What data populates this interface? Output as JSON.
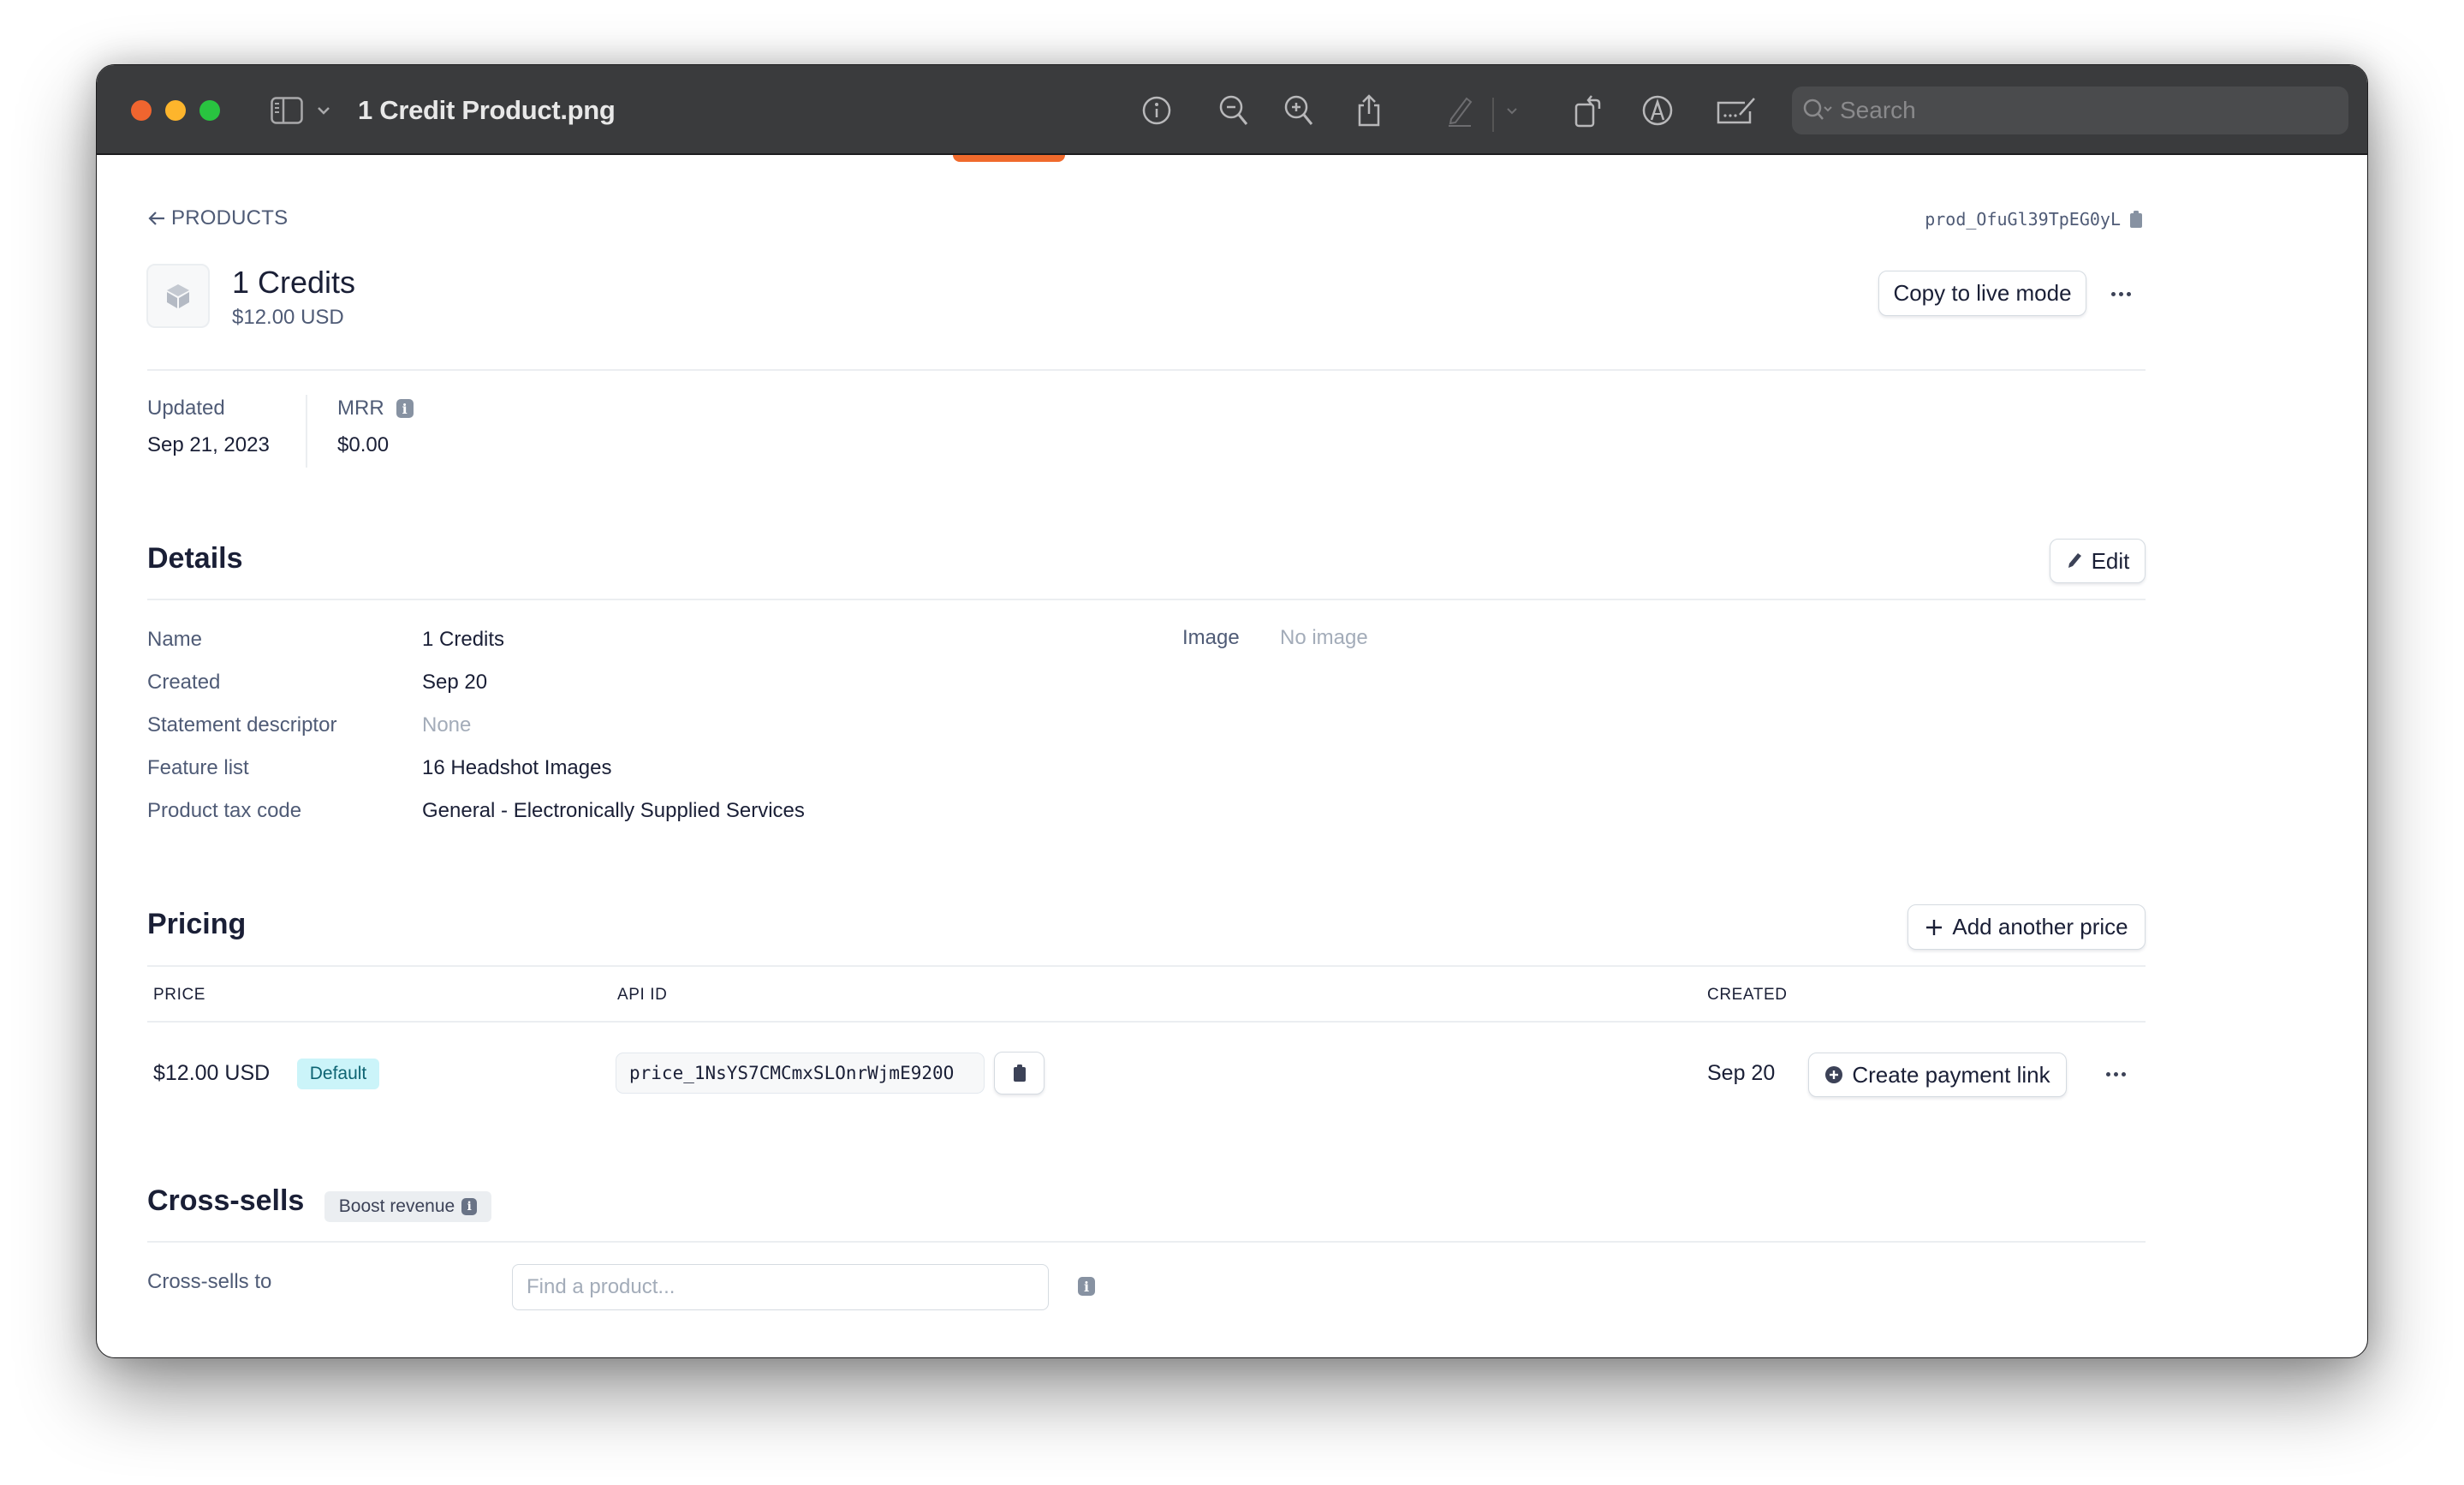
{
  "window": {
    "title": "1 Credit Product.png",
    "search_placeholder": "Search",
    "toolbar_icons": [
      "info-icon",
      "zoom-out-icon",
      "zoom-in-icon",
      "share-icon",
      "markup-pen-icon",
      "chevron-down-icon",
      "rotate-icon",
      "annotate-icon",
      "signature-icon"
    ],
    "traffic_lights": {
      "close": "#f0652f",
      "minimize": "#fdb52c",
      "maximize": "#29c440"
    }
  },
  "page": {
    "back_link": "PRODUCTS",
    "product_id": "prod_OfuGl39TpEG0yL",
    "product": {
      "name": "1 Credits",
      "price": "$12.00 USD"
    },
    "actions": {
      "copy_live": "Copy to live mode"
    },
    "stats": [
      {
        "label": "Updated",
        "value": "Sep 21, 2023"
      },
      {
        "label": "MRR",
        "value": "$0.00"
      }
    ],
    "details": {
      "title": "Details",
      "edit_label": "Edit",
      "rows": [
        {
          "label": "Name",
          "value": "1 Credits"
        },
        {
          "label": "Created",
          "value": "Sep 20"
        },
        {
          "label": "Statement descriptor",
          "value": "None"
        },
        {
          "label": "Feature list",
          "value": "16 Headshot Images"
        },
        {
          "label": "Product tax code",
          "value": "General - Electronically Supplied Services"
        }
      ],
      "image": {
        "label": "Image",
        "value": "No image"
      }
    },
    "pricing": {
      "title": "Pricing",
      "add_label": "Add another price",
      "columns": [
        "PRICE",
        "API ID",
        "CREATED"
      ],
      "rows": [
        {
          "price": "$12.00 USD",
          "badge": "Default",
          "api_id": "price_1NsYS7CMCmxSLOnrWjmE920O",
          "created": "Sep 20",
          "action": "Create payment link"
        }
      ]
    },
    "cross_sells": {
      "title": "Cross-sells",
      "badge": "Boost revenue",
      "field_label": "Cross-sells to",
      "input_placeholder": "Find a product...",
      "input_value": ""
    },
    "colors": {
      "accent_test": "#f06a2c",
      "badge_default_bg": "#cbf4f9",
      "badge_default_text": "#0e6473"
    }
  }
}
